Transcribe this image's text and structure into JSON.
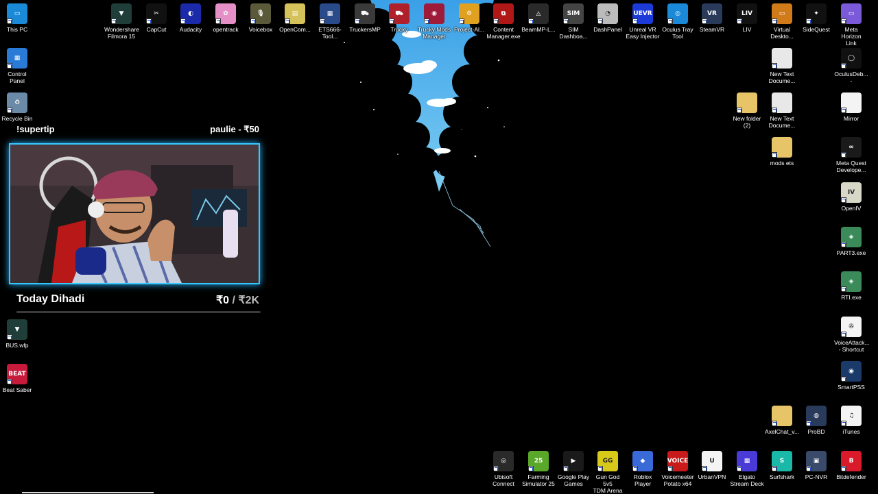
{
  "desktop": {
    "icons_top": [
      {
        "name": "wondershare-filmora-icon",
        "label": "Wondershare\nFilmora 15",
        "color": "#1f3e3a",
        "glyph": "▼"
      },
      {
        "name": "capcut-icon",
        "label": "CapCut",
        "color": "#111111",
        "glyph": "✂"
      },
      {
        "name": "audacity-icon",
        "label": "Audacity",
        "color": "#1b2aa8",
        "glyph": "◐"
      },
      {
        "name": "opentrack-icon",
        "label": "opentrack",
        "color": "#e58fc7",
        "glyph": "✿"
      },
      {
        "name": "voicebox-icon",
        "label": "Voicebox",
        "color": "#5a5a3a",
        "glyph": "🎙"
      },
      {
        "name": "opencomposite-icon",
        "label": "OpenCom...",
        "color": "#d6c25a",
        "glyph": "▤"
      },
      {
        "name": "ets666-tool-icon",
        "label": "ETS666-Tool...",
        "color": "#2a4b8a",
        "glyph": "▦"
      },
      {
        "name": "truckersmp-icon",
        "label": "TruckersMP",
        "color": "#3a3a3a",
        "glyph": "⛟"
      },
      {
        "name": "trucky-icon",
        "label": "Trucky",
        "color": "#b0202a",
        "glyph": "⛟"
      },
      {
        "name": "trucky-mods-manager-icon",
        "label": "Trucky Mods\nManager",
        "color": "#9e1c3a",
        "glyph": "◉"
      },
      {
        "name": "project-alpha-icon",
        "label": "Project-Al...",
        "color": "#e0a020",
        "glyph": "⚙"
      },
      {
        "name": "content-manager-icon",
        "label": "Content\nManager.exe",
        "color": "#b01818",
        "glyph": "⧉"
      },
      {
        "name": "beammp-launcher-icon",
        "label": "BeamMP-L...",
        "color": "#2a2a2a",
        "glyph": "◬"
      },
      {
        "name": "sim-dashboard-icon",
        "label": "SIM\nDashboa...",
        "color": "#444444",
        "glyph": "SIM"
      },
      {
        "name": "dashpanel-icon",
        "label": "DashPanel",
        "color": "#bbbbbb",
        "glyph": "◔"
      },
      {
        "name": "unreal-vr-injector-icon",
        "label": "Unreal VR\nEasy Injector",
        "color": "#1b3ad8",
        "glyph": "UEVR"
      },
      {
        "name": "oculus-tray-tool-icon",
        "label": "Oculus Tray\nTool",
        "color": "#1a8ad8",
        "glyph": "◎"
      },
      {
        "name": "steamvr-icon",
        "label": "SteamVR",
        "color": "#2a3a5a",
        "glyph": "VR"
      },
      {
        "name": "liv-icon",
        "label": "LIV",
        "color": "#111111",
        "glyph": "LIV"
      },
      {
        "name": "virtual-desktop-icon",
        "label": "Virtual\nDeskto...",
        "color": "#d07a1a",
        "glyph": "▭"
      },
      {
        "name": "sidequest-icon",
        "label": "SideQuest",
        "color": "#111111",
        "glyph": "✦"
      },
      {
        "name": "meta-horizon-link-icon",
        "label": "Meta Horizon\nLink",
        "color": "#7a5ad8",
        "glyph": "▭"
      }
    ],
    "icons_left": [
      {
        "name": "this-pc-icon",
        "label": "This PC",
        "color": "#1a8ad8",
        "glyph": "▭"
      },
      {
        "name": "control-panel-icon",
        "label": "Control Panel",
        "color": "#2a7ad8",
        "glyph": "▦"
      },
      {
        "name": "recycle-bin-icon",
        "label": "Recycle Bin",
        "color": "#6a8aa8",
        "glyph": "♻"
      },
      {
        "name": "bus-wfp-icon",
        "label": "BUS.wfp",
        "color": "#1f3e3a",
        "glyph": "▼"
      },
      {
        "name": "beat-saber-icon",
        "label": "Beat Saber",
        "color": "#c81a3a",
        "glyph": "BEAT"
      }
    ],
    "icons_right": [
      {
        "name": "new-text-document-icon",
        "label": "New Text\nDocume...",
        "color": "#e8e8e8",
        "glyph": ""
      },
      {
        "name": "oculus-debug-tool-icon",
        "label": "OculusDeb...\n-",
        "color": "#111111",
        "glyph": "◯"
      },
      {
        "name": "new-folder-2-icon",
        "label": "New folder\n(2)",
        "color": "#e8c468",
        "glyph": ""
      },
      {
        "name": "new-text-document-2-icon",
        "label": "New Text\nDocume...",
        "color": "#e8e8e8",
        "glyph": ""
      },
      {
        "name": "mirror-icon",
        "label": "Mirror",
        "color": "#f4f4f4",
        "glyph": ""
      },
      {
        "name": "mods-ets-folder-icon",
        "label": "mods ets",
        "color": "#e8c468",
        "glyph": ""
      },
      {
        "name": "meta-quest-developer-icon",
        "label": "Meta Quest\nDevelope...",
        "color": "#1a1a1a",
        "glyph": "∞"
      },
      {
        "name": "openiv-icon",
        "label": "OpenIV",
        "color": "#d8d8c8",
        "glyph": "IV"
      },
      {
        "name": "part3-exe-icon",
        "label": "PART3.exe",
        "color": "#3a8a5a",
        "glyph": "◈"
      },
      {
        "name": "rti-exe-icon",
        "label": "RTI.exe",
        "color": "#3a8a5a",
        "glyph": "◈"
      },
      {
        "name": "voiceattack-icon",
        "label": "VoiceAttack...\n- Shortcut",
        "color": "#f4f4f4",
        "glyph": "✇"
      },
      {
        "name": "smartpss-icon",
        "label": "SmartPSS",
        "color": "#1a3a6a",
        "glyph": "◉"
      },
      {
        "name": "axelchat-icon",
        "label": "AxelChat_v...",
        "color": "#e8c468",
        "glyph": ""
      },
      {
        "name": "probd-icon",
        "label": "ProBD",
        "color": "#2a3a5a",
        "glyph": "◍"
      },
      {
        "name": "itunes-icon",
        "label": "iTunes",
        "color": "#f4f4f4",
        "glyph": "♫"
      }
    ],
    "icons_bottom": [
      {
        "name": "ubisoft-connect-icon",
        "label": "Ubisoft\nConnect",
        "color": "#2a2a2a",
        "glyph": "◎"
      },
      {
        "name": "farming-simulator-25-icon",
        "label": "Farming\nSimulator 25",
        "color": "#5aa82a",
        "glyph": "25"
      },
      {
        "name": "google-play-games-icon",
        "label": "Google Play\nGames",
        "color": "#1a1a1a",
        "glyph": "▶"
      },
      {
        "name": "gun-god-icon",
        "label": "Gun God 5v5\nTDM Arena",
        "color": "#d8c81a",
        "glyph": "GG"
      },
      {
        "name": "roblox-player-icon",
        "label": "Roblox Player",
        "color": "#3a6ad8",
        "glyph": "◆"
      },
      {
        "name": "voicemeeter-icon",
        "label": "Voicemeeter\nPotato x64",
        "color": "#c81a1a",
        "glyph": "VOICE"
      },
      {
        "name": "urbanvpn-icon",
        "label": "UrbanVPN",
        "color": "#f4f4f4",
        "glyph": "U"
      },
      {
        "name": "elgato-stream-deck-icon",
        "label": "Elgato\nStream Deck",
        "color": "#4a3ad8",
        "glyph": "▦"
      },
      {
        "name": "surfshark-icon",
        "label": "Surfshark",
        "color": "#1ab8a8",
        "glyph": "S"
      },
      {
        "name": "pc-nvr-icon",
        "label": "PC-NVR",
        "color": "#3a4a6a",
        "glyph": "▣"
      },
      {
        "name": "bitdefender-icon",
        "label": "Bitdefender",
        "color": "#d81a2a",
        "glyph": "B"
      }
    ]
  },
  "overlay": {
    "supertip_label": "!supertip",
    "top_tip": "paulie - ₹50",
    "dihadi_title": "Today Dihadi",
    "dihadi_value": "₹0",
    "dihadi_goal": "/ ₹2K",
    "dihadi_progress": 0.0,
    "frame_color": "#35c8ff"
  }
}
